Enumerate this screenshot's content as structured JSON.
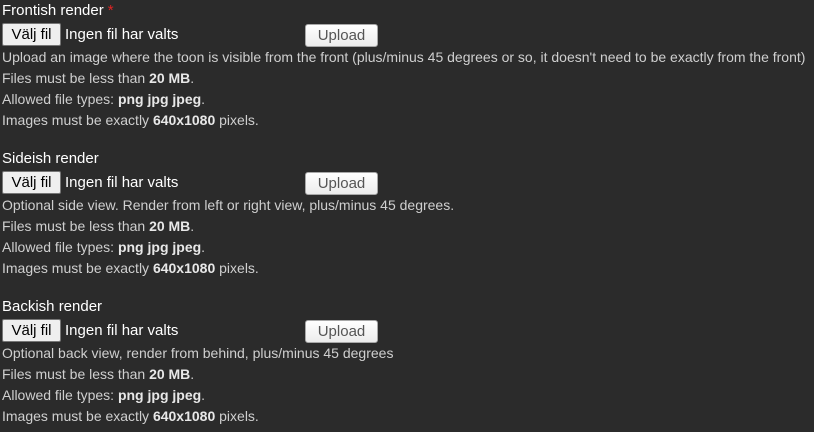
{
  "sections": [
    {
      "label": "Frontish render",
      "required_mark": "*",
      "choose_button": "Välj fil",
      "no_file_text": "Ingen fil har valts",
      "upload_button": "Upload",
      "description": "Upload an image where the toon is visible from the front (plus/minus 45 degrees or so, it doesn't need to be exactly from the front)",
      "size_prefix": "Files must be less than ",
      "size_value": "20 MB",
      "size_suffix": ".",
      "types_prefix": "Allowed file types: ",
      "types_value": "png jpg jpeg",
      "types_suffix": ".",
      "dims_prefix": "Images must be exactly ",
      "dims_value": "640x1080",
      "dims_suffix": " pixels."
    },
    {
      "label": "Sideish render",
      "choose_button": "Välj fil",
      "no_file_text": "Ingen fil har valts",
      "upload_button": "Upload",
      "description": "Optional side view. Render from left or right view, plus/minus 45 degrees.",
      "size_prefix": "Files must be less than ",
      "size_value": "20 MB",
      "size_suffix": ".",
      "types_prefix": "Allowed file types: ",
      "types_value": "png jpg jpeg",
      "types_suffix": ".",
      "dims_prefix": "Images must be exactly ",
      "dims_value": "640x1080",
      "dims_suffix": " pixels."
    },
    {
      "label": "Backish render",
      "choose_button": "Välj fil",
      "no_file_text": "Ingen fil har valts",
      "upload_button": "Upload",
      "description": "Optional back view, render from behind, plus/minus 45 degrees",
      "size_prefix": "Files must be less than ",
      "size_value": "20 MB",
      "size_suffix": ".",
      "types_prefix": "Allowed file types: ",
      "types_value": "png jpg jpeg",
      "types_suffix": ".",
      "dims_prefix": "Images must be exactly ",
      "dims_value": "640x1080",
      "dims_suffix": " pixels."
    }
  ],
  "colors": {
    "background": "#2b2b2b",
    "required": "#e02424",
    "text": "#ffffff",
    "muted_text": "#cfcfcf"
  }
}
